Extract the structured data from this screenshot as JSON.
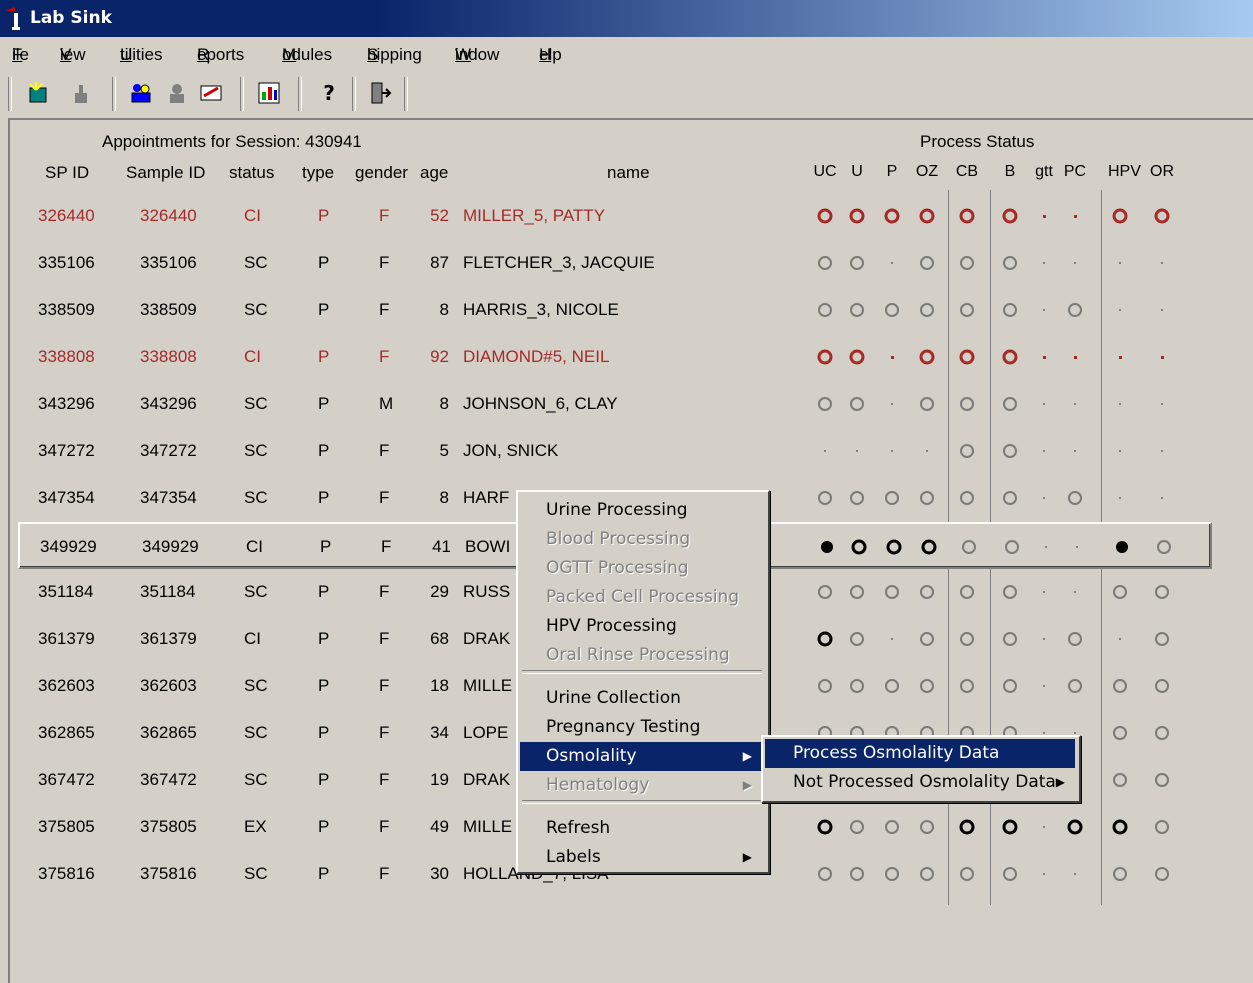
{
  "window": {
    "title": "Lab Sink"
  },
  "menubar": [
    "File",
    "View",
    "Utilities",
    "Reports",
    "Modules",
    "Shipping",
    "Window",
    "Help"
  ],
  "toolbar_icons": [
    "new-icon",
    "hand-icon",
    "group-icon",
    "person-icon",
    "edit-icon",
    "chart-icon",
    "help-icon",
    "exit-icon"
  ],
  "session_title": "Appointments for Session: 430941",
  "process_status_title": "Process Status",
  "columns": {
    "sp_id": "SP ID",
    "sample_id": "Sample ID",
    "status": "status",
    "type": "type",
    "gender": "gender",
    "age": "age",
    "name": "name"
  },
  "process_columns": [
    "UC",
    "U",
    "P",
    "OZ",
    "CB",
    "B",
    "gtt",
    "PC",
    "HPV",
    "OR"
  ],
  "colors": {
    "highlight": "#0a246a",
    "alert_red": "#a52a2a",
    "face": "#d4d0c8"
  },
  "rows": [
    {
      "sp_id": "326440",
      "sample_id": "326440",
      "status": "CI",
      "type": "P",
      "gender": "F",
      "age": "52",
      "name": "MILLER_5, PATTY",
      "red": true,
      "process": [
        "ring-red",
        "ring-red",
        "ring-red",
        "ring-red",
        "ring-red",
        "ring-red",
        "dot-red",
        "dot-red",
        "ring-red",
        "ring-red"
      ]
    },
    {
      "sp_id": "335106",
      "sample_id": "335106",
      "status": "SC",
      "type": "P",
      "gender": "F",
      "age": "87",
      "name": "FLETCHER_3, JACQUIE",
      "process": [
        "ring-gray",
        "ring-gray",
        "dot",
        "ring-gray",
        "ring-gray",
        "ring-gray",
        "dot",
        "dot",
        "dot",
        "dot"
      ]
    },
    {
      "sp_id": "338509",
      "sample_id": "338509",
      "status": "SC",
      "type": "P",
      "gender": "F",
      "age": "8",
      "name": "HARRIS_3, NICOLE",
      "process": [
        "ring-gray",
        "ring-gray",
        "ring-gray",
        "ring-gray",
        "ring-gray",
        "ring-gray",
        "dot",
        "ring-gray",
        "dot",
        "dot"
      ]
    },
    {
      "sp_id": "338808",
      "sample_id": "338808",
      "status": "CI",
      "type": "P",
      "gender": "F",
      "age": "92",
      "name": "DIAMOND#5, NEIL",
      "red": true,
      "process": [
        "ring-red",
        "ring-red",
        "dot-red",
        "ring-red",
        "ring-red",
        "ring-red",
        "dot-red",
        "dot-red",
        "dot-red",
        "dot-red"
      ]
    },
    {
      "sp_id": "343296",
      "sample_id": "343296",
      "status": "SC",
      "type": "P",
      "gender": "M",
      "age": "8",
      "name": "JOHNSON_6, CLAY",
      "process": [
        "ring-gray",
        "ring-gray",
        "dot",
        "ring-gray",
        "ring-gray",
        "ring-gray",
        "dot",
        "dot",
        "dot",
        "dot"
      ]
    },
    {
      "sp_id": "347272",
      "sample_id": "347272",
      "status": "SC",
      "type": "P",
      "gender": "F",
      "age": "5",
      "name": "JON, SNICK",
      "process": [
        "dot",
        "dot",
        "dot",
        "dot",
        "ring-gray",
        "ring-gray",
        "dot",
        "dot",
        "dot",
        "dot"
      ]
    },
    {
      "sp_id": "347354",
      "sample_id": "347354",
      "status": "SC",
      "type": "P",
      "gender": "F",
      "age": "8",
      "name": "HARF",
      "process": [
        "ring-gray",
        "ring-gray",
        "ring-gray",
        "ring-gray",
        "ring-gray",
        "ring-gray",
        "dot",
        "ring-gray",
        "dot",
        "dot"
      ]
    },
    {
      "sp_id": "349929",
      "sample_id": "349929",
      "status": "CI",
      "type": "P",
      "gender": "F",
      "age": "41",
      "name": "BOWI",
      "selected": true,
      "process": [
        "filled",
        "ring-black",
        "ring-black",
        "ring-black",
        "ring-gray",
        "ring-gray",
        "dot",
        "dot",
        "filled",
        "ring-gray"
      ]
    },
    {
      "sp_id": "351184",
      "sample_id": "351184",
      "status": "SC",
      "type": "P",
      "gender": "F",
      "age": "29",
      "name": "RUSS",
      "process": [
        "ring-gray",
        "ring-gray",
        "ring-gray",
        "ring-gray",
        "ring-gray",
        "ring-gray",
        "dot",
        "dot",
        "ring-gray",
        "ring-gray"
      ]
    },
    {
      "sp_id": "361379",
      "sample_id": "361379",
      "status": "CI",
      "type": "P",
      "gender": "F",
      "age": "68",
      "name": "DRAK",
      "process": [
        "ring-black",
        "ring-gray",
        "dot",
        "ring-gray",
        "ring-gray",
        "ring-gray",
        "dot",
        "ring-gray",
        "dot",
        "ring-gray"
      ]
    },
    {
      "sp_id": "362603",
      "sample_id": "362603",
      "status": "SC",
      "type": "P",
      "gender": "F",
      "age": "18",
      "name": "MILLE",
      "process": [
        "ring-gray",
        "ring-gray",
        "ring-gray",
        "ring-gray",
        "ring-gray",
        "ring-gray",
        "dot",
        "ring-gray",
        "ring-gray",
        "ring-gray"
      ]
    },
    {
      "sp_id": "362865",
      "sample_id": "362865",
      "status": "SC",
      "type": "P",
      "gender": "F",
      "age": "34",
      "name": "LOPE",
      "process": [
        "ring-gray",
        "ring-gray",
        "ring-gray",
        "ring-gray",
        "ring-gray",
        "ring-gray",
        "dot",
        "dot",
        "ring-gray",
        "ring-gray"
      ]
    },
    {
      "sp_id": "367472",
      "sample_id": "367472",
      "status": "SC",
      "type": "P",
      "gender": "F",
      "age": "19",
      "name": "DRAK",
      "process": [
        "ring-gray",
        "ring-gray",
        "ring-gray",
        "ring-gray",
        "ring-gray",
        "ring-gray",
        "dot",
        "dot",
        "ring-gray",
        "ring-gray"
      ]
    },
    {
      "sp_id": "375805",
      "sample_id": "375805",
      "status": "EX",
      "type": "P",
      "gender": "F",
      "age": "49",
      "name": "MILLE",
      "process": [
        "ring-black",
        "ring-gray",
        "ring-gray",
        "ring-gray",
        "ring-black",
        "ring-black",
        "dot",
        "ring-black",
        "ring-black",
        "ring-gray"
      ]
    },
    {
      "sp_id": "375816",
      "sample_id": "375816",
      "status": "SC",
      "type": "P",
      "gender": "F",
      "age": "30",
      "name": "HOLLAND_7, LISA",
      "process": [
        "ring-gray",
        "ring-gray",
        "ring-gray",
        "ring-gray",
        "ring-gray",
        "ring-gray",
        "dot",
        "dot",
        "ring-gray",
        "ring-gray"
      ]
    }
  ],
  "context_menu": [
    {
      "label": "Urine Processing",
      "enabled": true
    },
    {
      "label": "Blood Processing",
      "enabled": false
    },
    {
      "label": "OGTT Processing",
      "enabled": false
    },
    {
      "label": "Packed Cell Processing",
      "enabled": false
    },
    {
      "label": "HPV Processing",
      "enabled": true
    },
    {
      "label": "Oral Rinse Processing",
      "enabled": false
    },
    {
      "label": "Urine Collection",
      "enabled": true
    },
    {
      "label": "Pregnancy Testing",
      "enabled": true
    },
    {
      "label": "Osmolality",
      "enabled": true,
      "submenu": true,
      "highlighted": true
    },
    {
      "label": "Hematology",
      "enabled": false,
      "submenu": true
    },
    {
      "label": "Refresh",
      "enabled": true
    },
    {
      "label": "Labels",
      "enabled": true,
      "submenu": true
    }
  ],
  "submenu": [
    {
      "label": "Process Osmolality Data",
      "highlighted": true
    },
    {
      "label": "Not Processed Osmolality Data",
      "submenu": true
    }
  ]
}
